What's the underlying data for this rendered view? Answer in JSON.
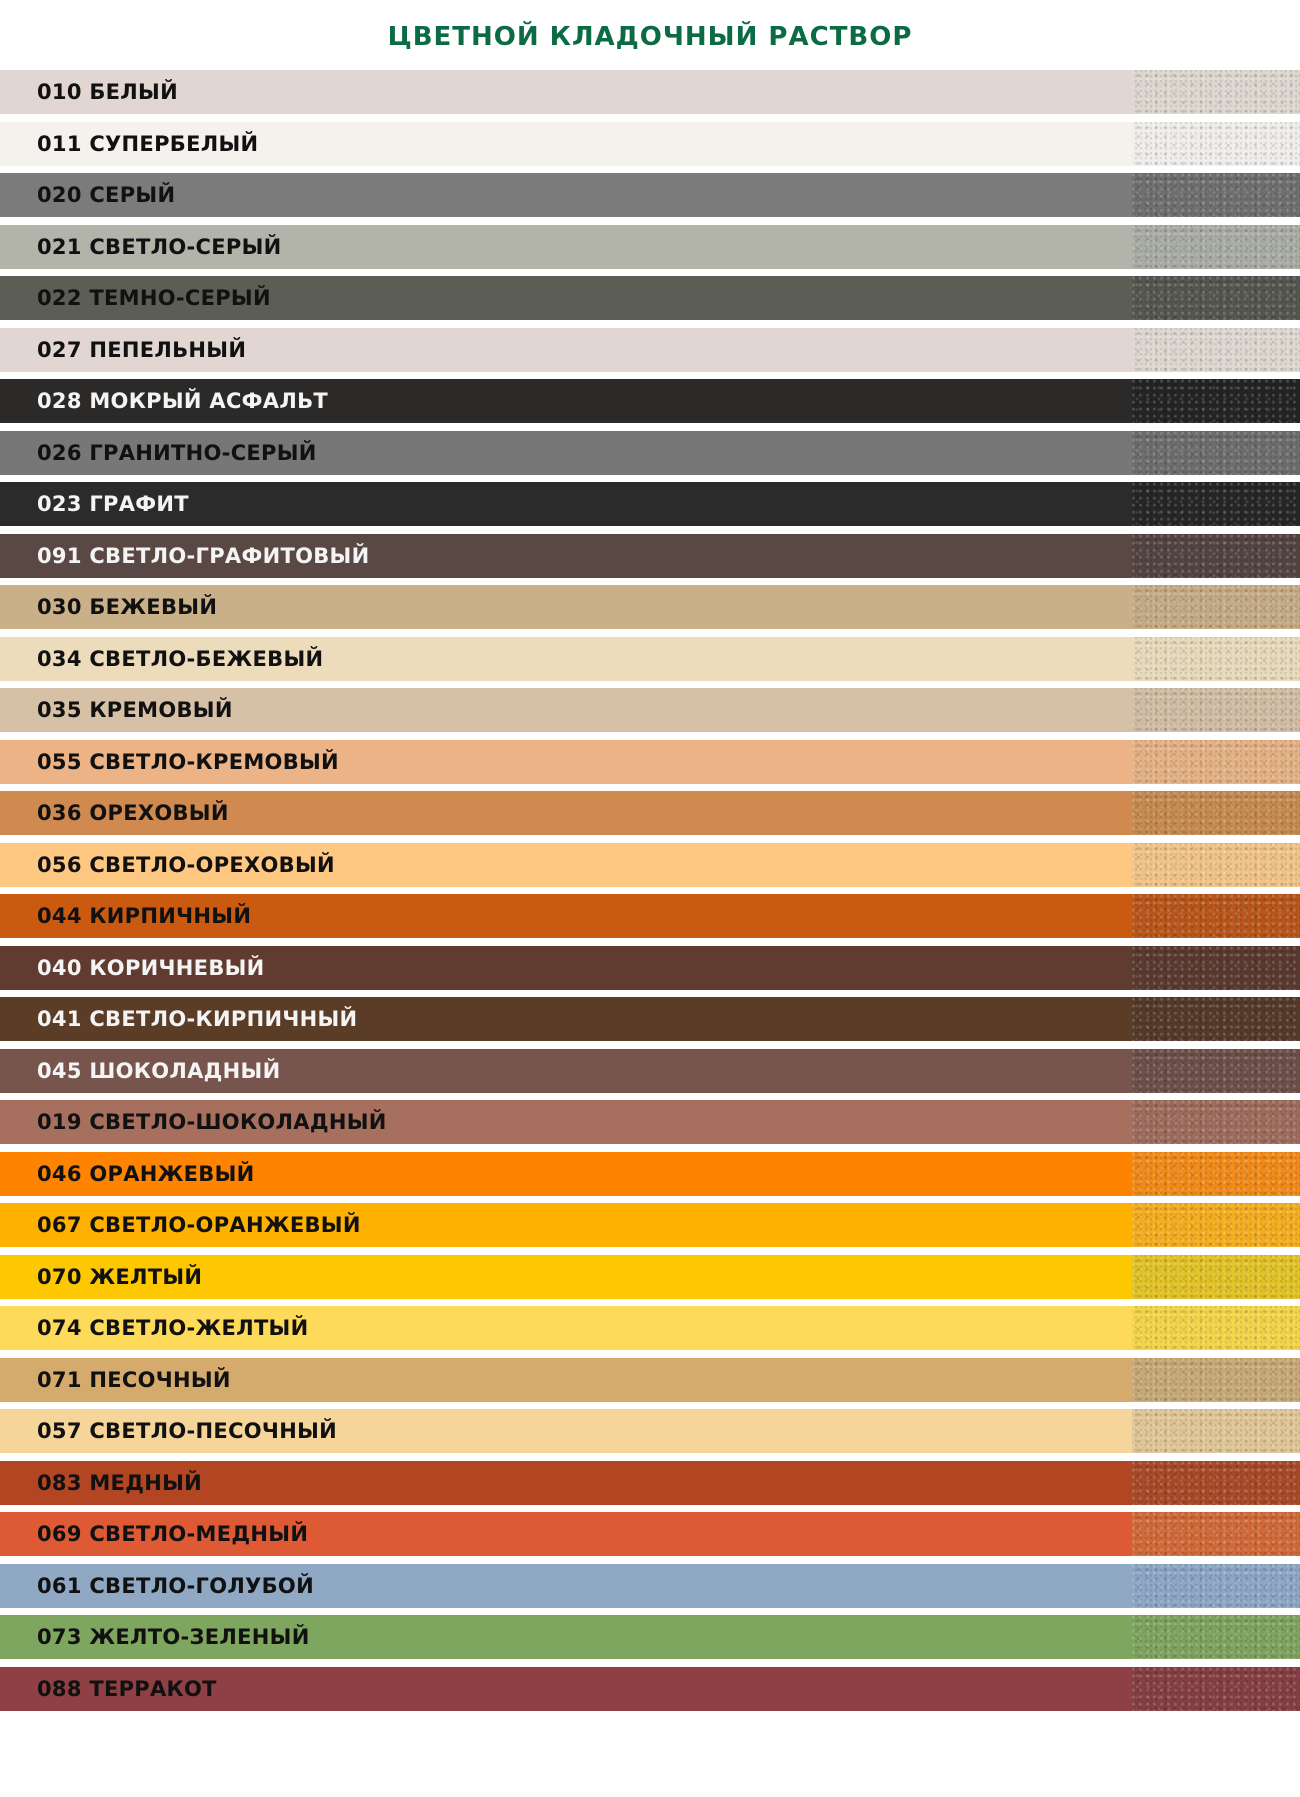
{
  "title": "ЦВЕТНОЙ КЛАДОЧНЫЙ РАСТВОР",
  "colors": [
    {
      "label": "010 БЕЛЫЙ",
      "color": "#e1d6d1",
      "texture": "#ddd7d0",
      "text": "dark"
    },
    {
      "label": "011 СУПЕРБЕЛЫЙ",
      "color": "#f5f2ee",
      "texture": "#f0eeeb",
      "text": "dark"
    },
    {
      "label": "020 СЕРЫЙ",
      "color": "#7b7b7b",
      "texture": "#6f6f6f",
      "text": "dark"
    },
    {
      "label": "021 СВЕТЛО-СЕРЫЙ",
      "color": "#b2b4aa",
      "texture": "#a9aba5",
      "text": "dark"
    },
    {
      "label": "022 ТЕМНО-СЕРЫЙ",
      "color": "#5c5e56",
      "texture": "#55564f",
      "text": "dark"
    },
    {
      "label": "027 ПЕПЕЛЬНЫЙ",
      "color": "#e1d6d1",
      "texture": "#ddd7d0",
      "text": "dark"
    },
    {
      "label": "028 МОКРЫЙ АСФАЛЬТ",
      "color": "#2b2a29",
      "texture": "#252424",
      "text": "light"
    },
    {
      "label": "026 ГРАНИТНО-СЕРЫЙ",
      "color": "#777777",
      "texture": "#6d6d6d",
      "text": "dark"
    },
    {
      "label": "023 ГРАФИТ",
      "color": "#2c2b2b",
      "texture": "#262626",
      "text": "light"
    },
    {
      "label": "091 СВЕТЛО-ГРАФИТОВЫЙ",
      "color": "#5a4844",
      "texture": "#544441",
      "text": "light"
    },
    {
      "label": "030 БЕЖЕВЫЙ",
      "color": "#c9b089",
      "texture": "#c4ab86",
      "text": "dark"
    },
    {
      "label": "034 СВЕТЛО-БЕЖЕВЫЙ",
      "color": "#ecdcbb",
      "texture": "#e8d9bb",
      "text": "dark"
    },
    {
      "label": "035 КРЕМОВЫЙ",
      "color": "#d6c1a6",
      "texture": "#d0bda4",
      "text": "dark"
    },
    {
      "label": "055 СВЕТЛО-КРЕМОВЫЙ",
      "color": "#ebb386",
      "texture": "#e4b184",
      "text": "dark"
    },
    {
      "label": "036 ОРЕХОВЫЙ",
      "color": "#d08a4f",
      "texture": "#c58a50",
      "text": "dark"
    },
    {
      "label": "056 СВЕТЛО-ОРЕХОВЫЙ",
      "color": "#fec883",
      "texture": "#f0c488",
      "text": "dark"
    },
    {
      "label": "044 КИРПИЧНЫЙ",
      "color": "#ca5a10",
      "texture": "#b8561b",
      "text": "dark"
    },
    {
      "label": "040 КОРИЧНЕВЫЙ",
      "color": "#603b2f",
      "texture": "#5a3a30",
      "text": "light"
    },
    {
      "label": "041 СВЕТЛО-КИРПИЧНЫЙ",
      "color": "#5b3c27",
      "texture": "#543a28",
      "text": "light"
    },
    {
      "label": "045 ШОКОЛАДНЫЙ",
      "color": "#77554d",
      "texture": "#6c5049",
      "text": "light"
    },
    {
      "label": "019 СВЕТЛО-ШОКОЛАДНЫЙ",
      "color": "#a66f5e",
      "texture": "#9d6c5d",
      "text": "dark"
    },
    {
      "label": "046 ОРАНЖЕВЫЙ",
      "color": "#fe8300",
      "texture": "#f08a19",
      "text": "dark"
    },
    {
      "label": "067 СВЕТЛО-ОРАНЖЕВЫЙ",
      "color": "#feb100",
      "texture": "#f3ad1f",
      "text": "dark"
    },
    {
      "label": "070 ЖЕЛТЫЙ",
      "color": "#fec800",
      "texture": "#e2c227",
      "text": "dark"
    },
    {
      "label": "074 СВЕТЛО-ЖЕЛТЫЙ",
      "color": "#feda5a",
      "texture": "#f3d449",
      "text": "dark"
    },
    {
      "label": "071 ПЕСОЧНЫЙ",
      "color": "#d4aa6d",
      "texture": "#c7a877",
      "text": "dark"
    },
    {
      "label": "057 СВЕТЛО-ПЕСОЧНЫЙ",
      "color": "#f6d59b",
      "texture": "#dfc696",
      "text": "dark"
    },
    {
      "label": "083 МЕДНЫЙ",
      "color": "#b34622",
      "texture": "#a84928",
      "text": "dark"
    },
    {
      "label": "069 СВЕТЛО-МЕДНЫЙ",
      "color": "#dd5a34",
      "texture": "#d06a39",
      "text": "dark"
    },
    {
      "label": "061 СВЕТЛО-ГОЛУБОЙ",
      "color": "#8fa8c3",
      "texture": "#8da6c5",
      "text": "dark"
    },
    {
      "label": "073 ЖЕЛТО-ЗЕЛЕНЫЙ",
      "color": "#7ea65f",
      "texture": "#7ea35f",
      "text": "dark"
    },
    {
      "label": "088 ТЕРРАКОТ",
      "color": "#8e4044",
      "texture": "#843f43",
      "text": "dark"
    }
  ]
}
